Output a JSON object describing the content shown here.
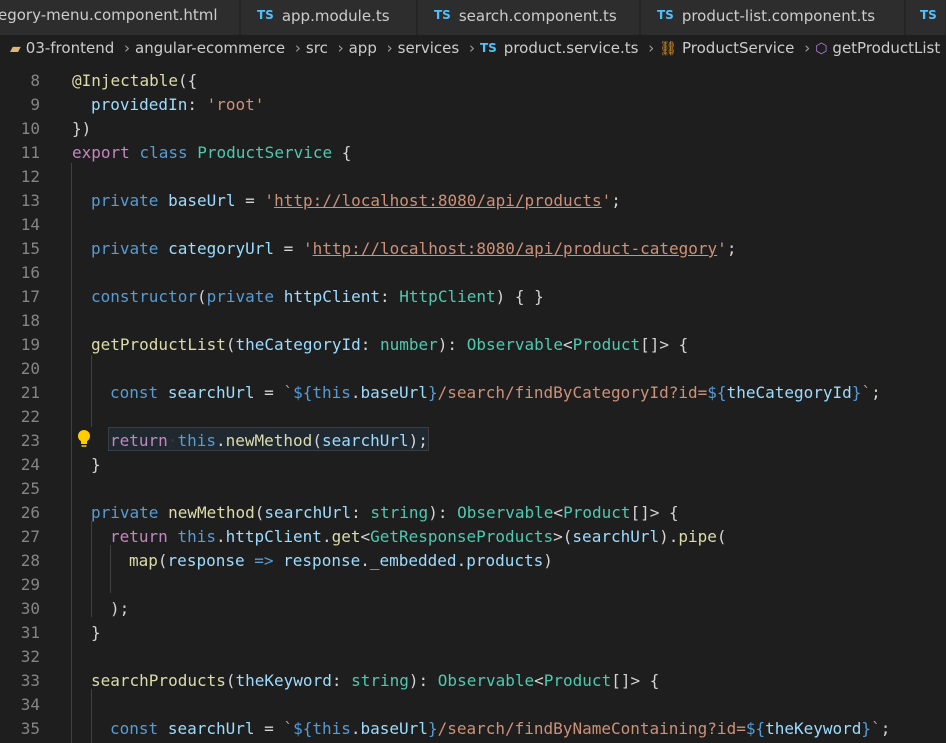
{
  "tabs": [
    {
      "name": "egory-menu.component.html",
      "icon": "html"
    },
    {
      "name": "app.module.ts",
      "icon": "ts"
    },
    {
      "name": "search.component.ts",
      "icon": "ts"
    },
    {
      "name": "product-list.component.ts",
      "icon": "ts"
    },
    {
      "name": "",
      "icon": "ts"
    }
  ],
  "ts_badge": "TS",
  "breadcrumb": {
    "items": [
      "03-frontend",
      "angular-ecommerce",
      "src",
      "app",
      "services",
      "product.service.ts",
      "ProductService",
      "getProductList"
    ]
  },
  "line_numbers": [
    "8",
    "9",
    "10",
    "11",
    "12",
    "13",
    "14",
    "15",
    "16",
    "17",
    "18",
    "19",
    "20",
    "21",
    "22",
    "23",
    "24",
    "25",
    "26",
    "27",
    "28",
    "29",
    "30",
    "31",
    "32",
    "33",
    "34",
    "35"
  ],
  "code": {
    "l8": [
      "@",
      "Injectable",
      "({"
    ],
    "l9": [
      "providedIn",
      ": ",
      "'root'"
    ],
    "l10": [
      "})"
    ],
    "l11": [
      "export",
      " ",
      "class",
      " ",
      "ProductService",
      " {"
    ],
    "l13": [
      "private",
      " ",
      "baseUrl",
      " = ",
      "'",
      "http://localhost:8080/api/products",
      "'",
      ";"
    ],
    "l15": [
      "private",
      " ",
      "categoryUrl",
      " = ",
      "'",
      "http://localhost:8080/api/product-category",
      "'",
      ";"
    ],
    "l17": [
      "constructor",
      "(",
      "private",
      " ",
      "httpClient",
      ": ",
      "HttpClient",
      ") { }"
    ],
    "l19": [
      "getProductList",
      "(",
      "theCategoryId",
      ": ",
      "number",
      "): ",
      "Observable",
      "<",
      "Product",
      "[]> {"
    ],
    "l21": [
      "const",
      " ",
      "searchUrl",
      " = ",
      "`",
      "${",
      "this",
      ".",
      "baseUrl",
      "}",
      "/search/findByCategoryId?id=",
      "${",
      "theCategoryId",
      "}",
      "`",
      ";"
    ],
    "l23": [
      "return",
      "·",
      "this",
      ".",
      "newMethod",
      "(",
      "searchUrl",
      ");"
    ],
    "l24": [
      "}"
    ],
    "l26": [
      "private",
      " ",
      "newMethod",
      "(",
      "searchUrl",
      ": ",
      "string",
      "): ",
      "Observable",
      "<",
      "Product",
      "[]> {"
    ],
    "l27": [
      "return",
      " ",
      "this",
      ".",
      "httpClient",
      ".",
      "get",
      "<",
      "GetResponseProducts",
      ">(",
      "searchUrl",
      ").",
      "pipe",
      "("
    ],
    "l28": [
      "map",
      "(",
      "response",
      " ",
      "=>",
      " ",
      "response",
      ".",
      "_embedded",
      ".",
      "products",
      ")"
    ],
    "l30": [
      ");"
    ],
    "l31": [
      "}"
    ],
    "l33": [
      "searchProducts",
      "(",
      "theKeyword",
      ": ",
      "string",
      "): ",
      "Observable",
      "<",
      "Product",
      "[]> {"
    ],
    "l35": [
      "const",
      " ",
      "searchUrl",
      " = ",
      "`",
      "${",
      "this",
      ".",
      "baseUrl",
      "}",
      "/search/findByNameContaining?id=",
      "${",
      "theKeyword",
      "}",
      "`",
      ";"
    ]
  },
  "colors": {
    "background": "#1e1e1e",
    "keyword": "#569cd6",
    "control": "#c586c0",
    "function": "#dcdcaa",
    "type": "#4ec9b0",
    "string": "#ce9178",
    "variable": "#9cdcfe",
    "lightbulb": "#ffcc00"
  }
}
